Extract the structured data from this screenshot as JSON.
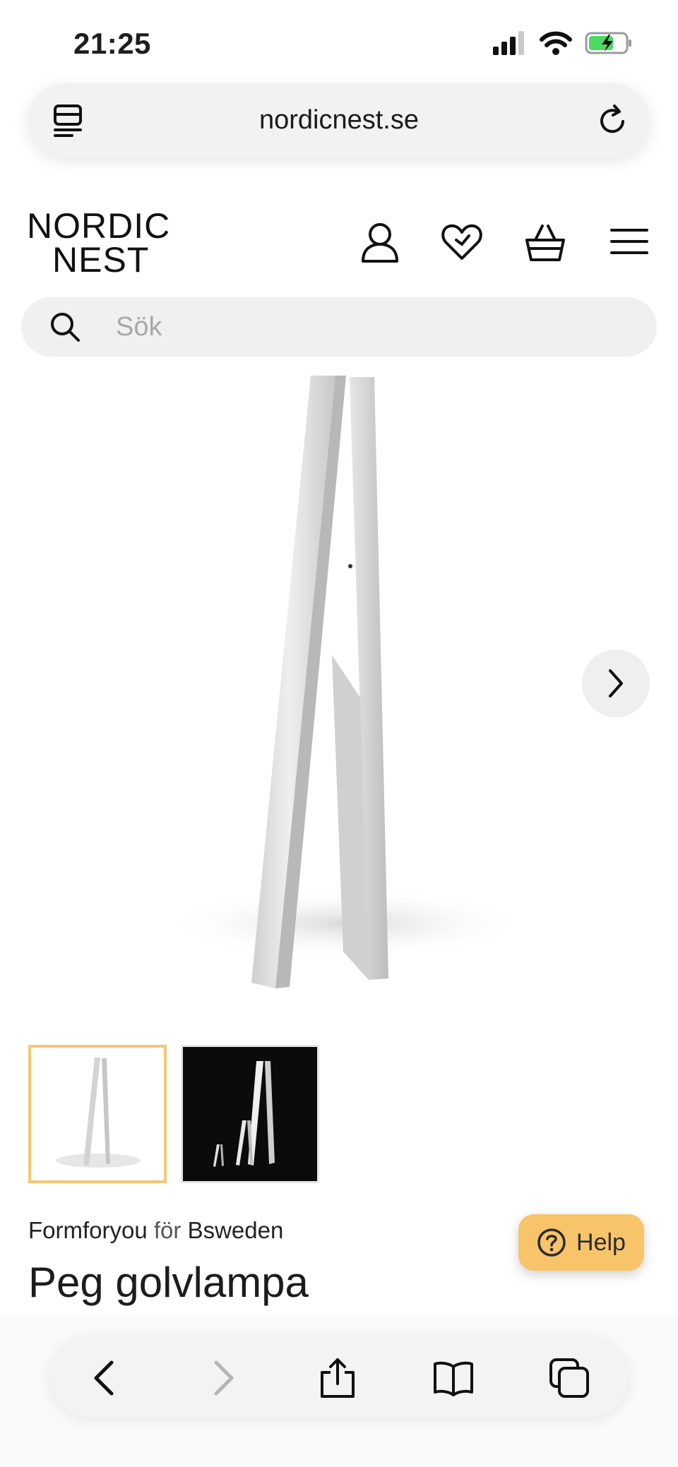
{
  "status_bar": {
    "time": "21:25",
    "icons": [
      "cellular-signal-icon",
      "wifi-icon",
      "battery-charging-icon"
    ],
    "battery_color": "#4cd964"
  },
  "browser": {
    "url": "nordicnest.se",
    "left_icon": "tab-overview-icon",
    "right_icon": "reload-icon"
  },
  "header": {
    "logo_line1": "NORDIC",
    "logo_line2": "NEST",
    "icons": [
      "account-icon",
      "wishlist-heart-icon",
      "basket-icon",
      "menu-icon"
    ]
  },
  "search": {
    "placeholder": "Sök",
    "icon": "search-icon"
  },
  "gallery": {
    "main_image": "floor-lamp-photo",
    "next_icon": "chevron-right-icon",
    "selected_thumbnail": 1,
    "thumbnails": [
      "lamp-white-background",
      "lamps-black-background"
    ],
    "selected_color": "#f3c776"
  },
  "product": {
    "designer": "Formforyou",
    "for_word": "för",
    "brand": "Bsweden",
    "title": "Peg golvlampa"
  },
  "help": {
    "label": "Help",
    "color": "#f7c469",
    "icon": "question-circle-icon"
  },
  "toolbar": {
    "icons": [
      "back-icon",
      "forward-icon",
      "share-icon",
      "bookmarks-icon",
      "tabs-icon"
    ],
    "forward_enabled": false
  }
}
